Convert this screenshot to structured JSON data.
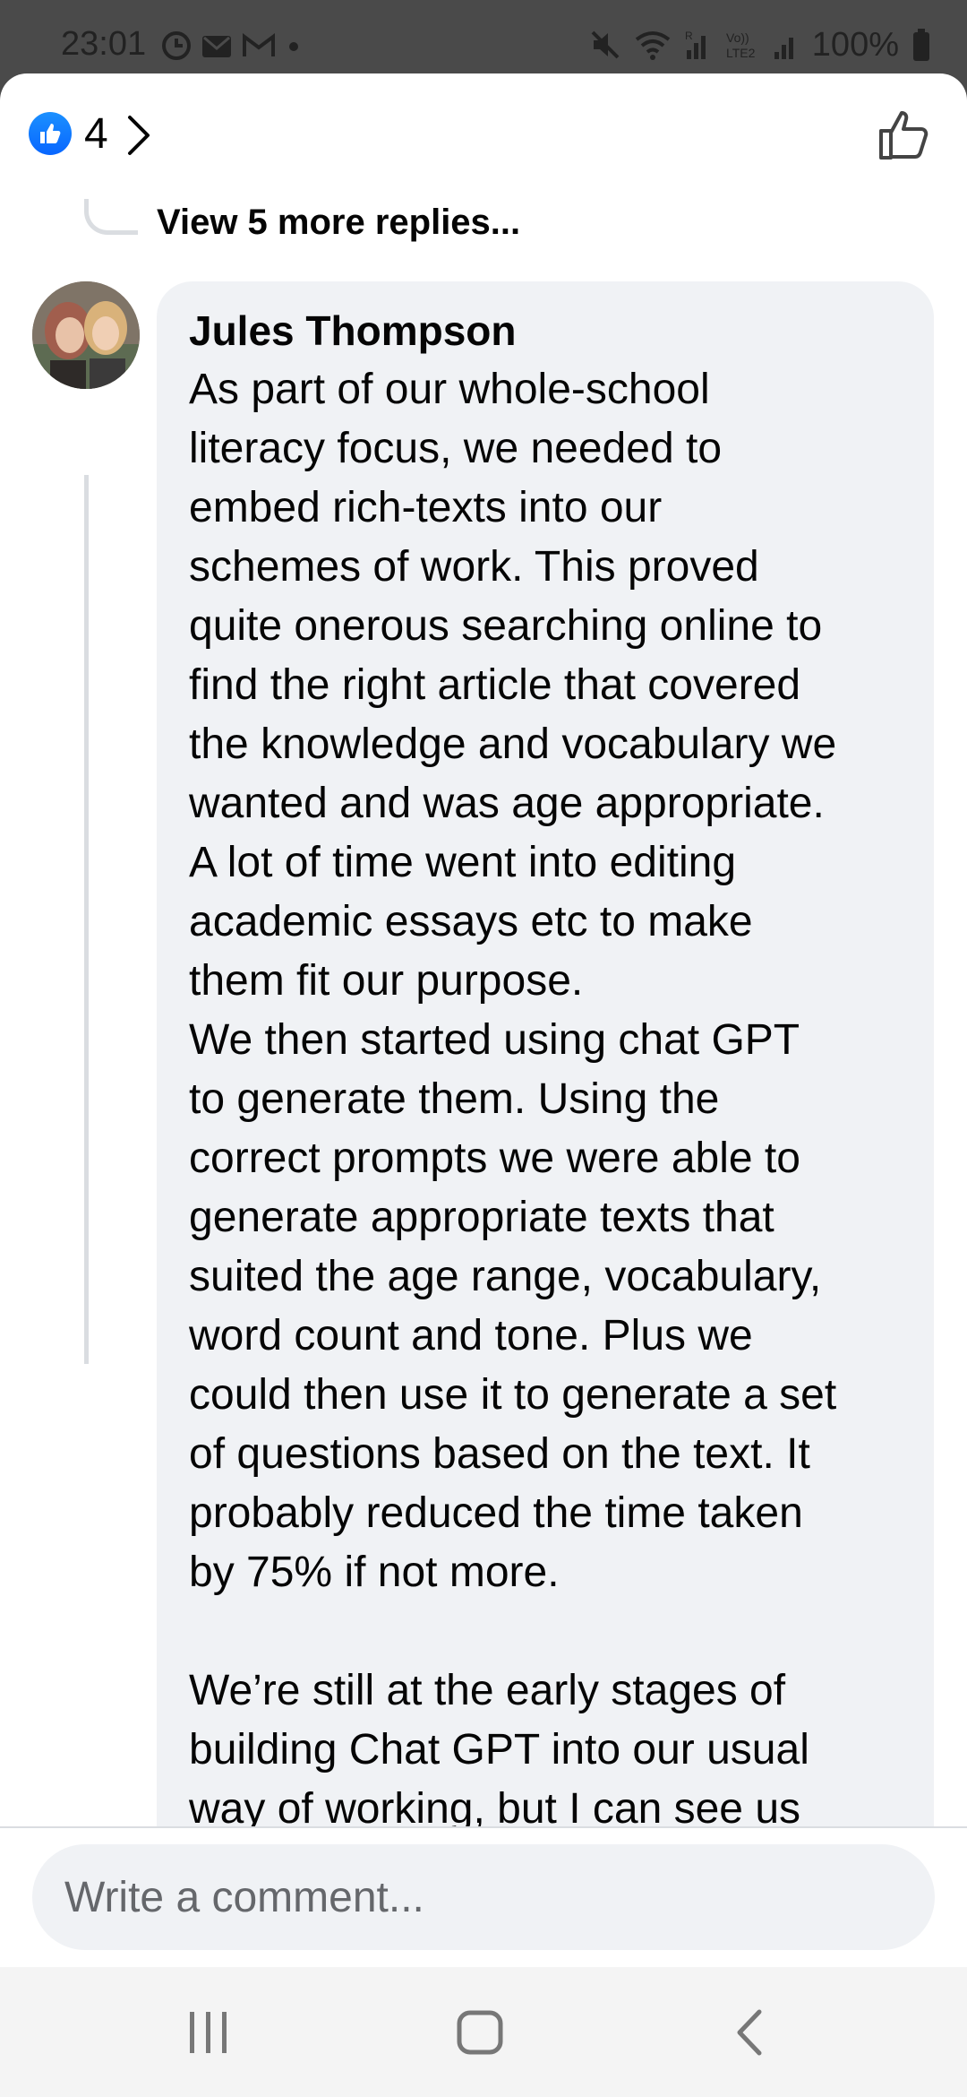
{
  "status_bar": {
    "time": "23:01",
    "battery": "100%",
    "left_icons": [
      "sync-icon",
      "mail-icon",
      "gmail-icon",
      "dot-icon"
    ],
    "right_icons": [
      "mute-icon",
      "wifi-icon",
      "signal-r-icon",
      "volte-icon",
      "signal-icon",
      "battery-icon"
    ]
  },
  "header": {
    "reaction_count": "4",
    "reaction_icon": "like-reaction-icon",
    "like_button_icon": "thumbs-up-icon"
  },
  "thread": {
    "view_more_label": "View 5 more replies...",
    "comment": {
      "author": "Jules Thompson",
      "lines": [
        "As part of our whole-school",
        "literacy focus, we needed to",
        "embed rich-texts into our",
        "schemes of work. This proved",
        "quite onerous searching online to",
        "find the right article that covered",
        "the knowledge and vocabulary we",
        "wanted and was age appropriate.",
        "A lot of time went into editing",
        "academic essays etc to make",
        "them fit our purpose.",
        "We then started using chat GPT",
        "to generate them. Using the",
        "correct prompts we were able to",
        "generate appropriate texts that",
        "suited the age range, vocabulary,",
        "word count and tone. Plus we",
        "could then use it to generate a set",
        "of questions based on the text. It",
        "probably reduced the time taken",
        "by 75% if not more.",
        "",
        "We’re still at the early stages of",
        "building Chat GPT into our usual",
        "way of working, but I can see us"
      ]
    }
  },
  "composer": {
    "placeholder": "Write a comment..."
  },
  "colors": {
    "accent": "#0866ff",
    "bubble": "#f0f2f5",
    "text": "#050505",
    "muted": "#65676b"
  }
}
